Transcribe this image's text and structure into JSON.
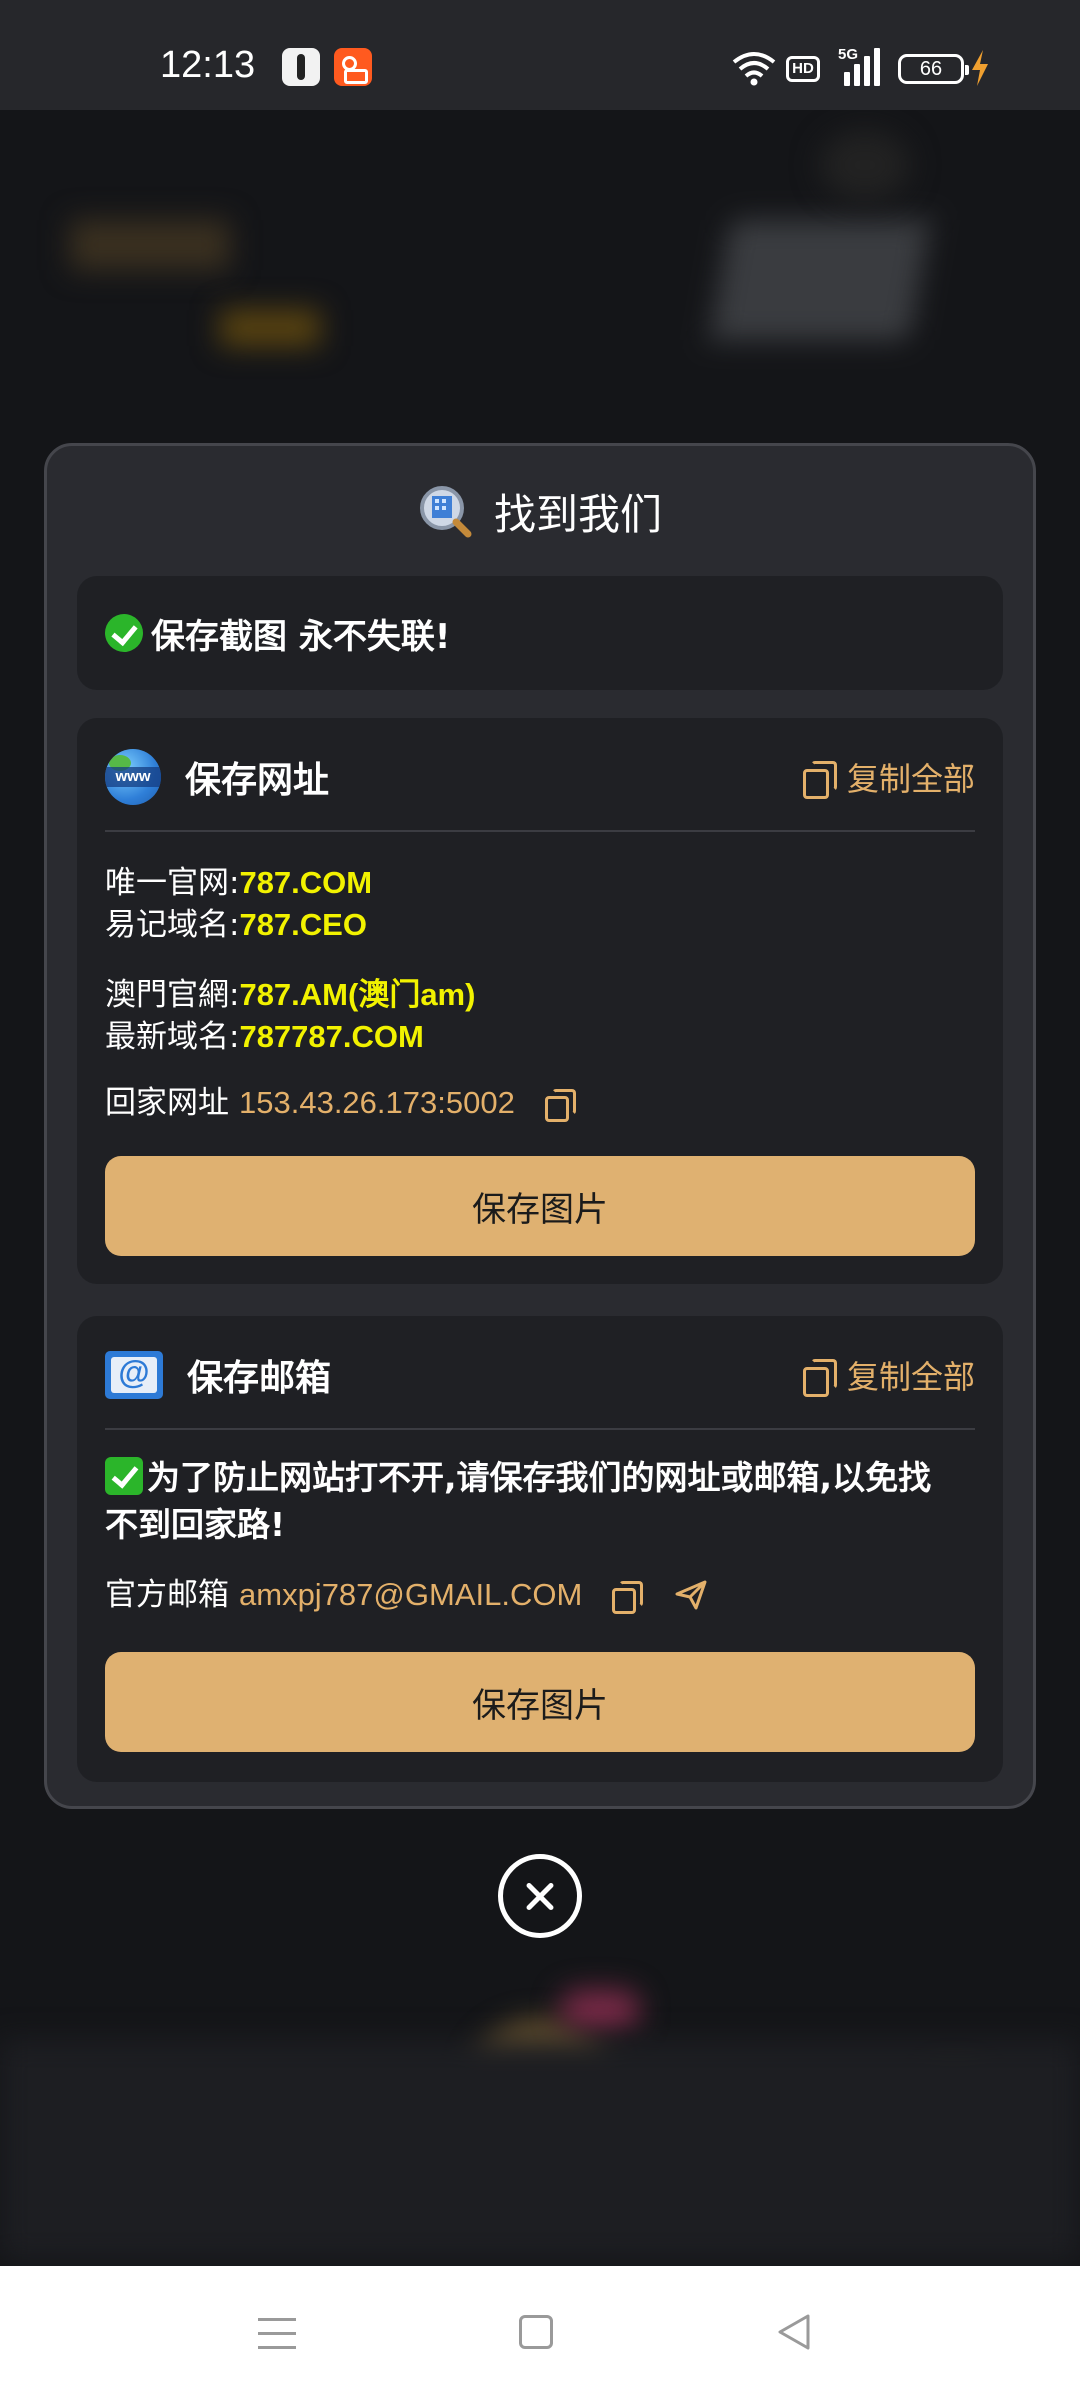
{
  "status_bar": {
    "time": "12:13",
    "hd": "HD",
    "network": "5G",
    "battery": "66"
  },
  "modal": {
    "title": "找到我们",
    "title_icon": "search-building-icon",
    "tip": "保存截图 永不失联!",
    "url_section": {
      "title": "保存网址",
      "copy_all": "复制全部",
      "entries": [
        {
          "label": "唯一官网:",
          "value": "787.COM"
        },
        {
          "label": "易记域名:",
          "value": "787.CEO"
        },
        {
          "label": "澳門官網:",
          "value": "787.AM(澳门am)"
        },
        {
          "label": "最新域名:",
          "value": "787787.COM"
        }
      ],
      "home_label": "回家网址",
      "home_address": "153.43.26.173:5002",
      "save_button": "保存图片"
    },
    "mail_section": {
      "title": "保存邮箱",
      "copy_all": "复制全部",
      "note": "为了防止网站打不开,请保存我们的网址或邮箱,以免找不到回家路!",
      "email_label": "官方邮箱",
      "email": "amxpj787@GMAIL.COM",
      "save_button": "保存图片"
    }
  },
  "colors": {
    "accent": "#dfb171",
    "link": "#e3b06a",
    "highlight": "#f2f200",
    "modal_bg": "#2a2b30",
    "card_bg": "#1f2024"
  }
}
